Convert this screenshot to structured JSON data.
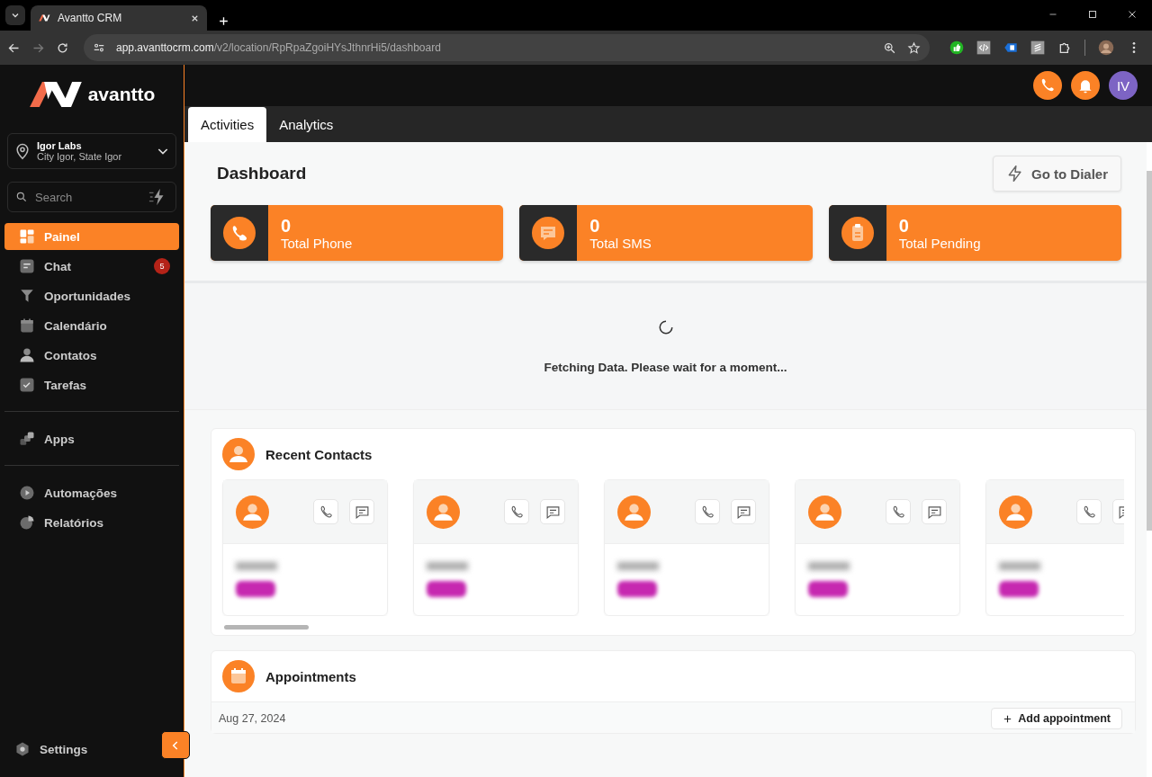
{
  "browser": {
    "tab_title": "Avantto CRM",
    "url_host": "app.avanttocrm.com",
    "url_path": "/v2/location/RpRpaZgoiHYsJthnrHi5/dashboard"
  },
  "sidebar": {
    "logo": "avantto",
    "location": {
      "name": "Igor Labs",
      "address": "City Igor, State Igor"
    },
    "search": {
      "placeholder": "Search"
    },
    "groups": [
      [
        {
          "label": "Painel",
          "kind": "dashboard",
          "selected": true
        },
        {
          "label": "Chat",
          "kind": "chat",
          "selected": false,
          "badge": "5"
        },
        {
          "label": "Oportunidades",
          "kind": "funnel",
          "selected": false
        },
        {
          "label": "Calendário",
          "kind": "calendar",
          "selected": false
        },
        {
          "label": "Contatos",
          "kind": "person",
          "selected": false
        },
        {
          "label": "Tarefas",
          "kind": "check",
          "selected": false
        }
      ],
      [
        {
          "label": "Apps",
          "kind": "apps",
          "selected": false
        }
      ],
      [
        {
          "label": "Automações",
          "kind": "play",
          "selected": false
        },
        {
          "label": "Relatórios",
          "kind": "pie",
          "selected": false
        }
      ]
    ],
    "settings": "Settings"
  },
  "header": {
    "avatar_initials": "IV"
  },
  "tabs": [
    {
      "label": "Activities",
      "selected": true
    },
    {
      "label": "Analytics",
      "selected": false
    }
  ],
  "dashboard": {
    "title": "Dashboard",
    "dialer_button": "Go to Dialer",
    "stats": [
      {
        "value": "0",
        "label": "Total Phone",
        "kind": "phone"
      },
      {
        "value": "0",
        "label": "Total SMS",
        "kind": "sms"
      },
      {
        "value": "0",
        "label": "Total Pending",
        "kind": "pending"
      }
    ],
    "loading_message": "Fetching Data. Please wait for a moment..."
  },
  "recent_contacts": {
    "title": "Recent Contacts",
    "contacts": [
      {
        "redacted": true
      },
      {
        "redacted": true
      },
      {
        "redacted": true
      },
      {
        "redacted": true
      },
      {
        "redacted": true
      }
    ]
  },
  "appointments": {
    "title": "Appointments",
    "date": "Aug 27, 2024",
    "add_button": "Add appointment"
  }
}
